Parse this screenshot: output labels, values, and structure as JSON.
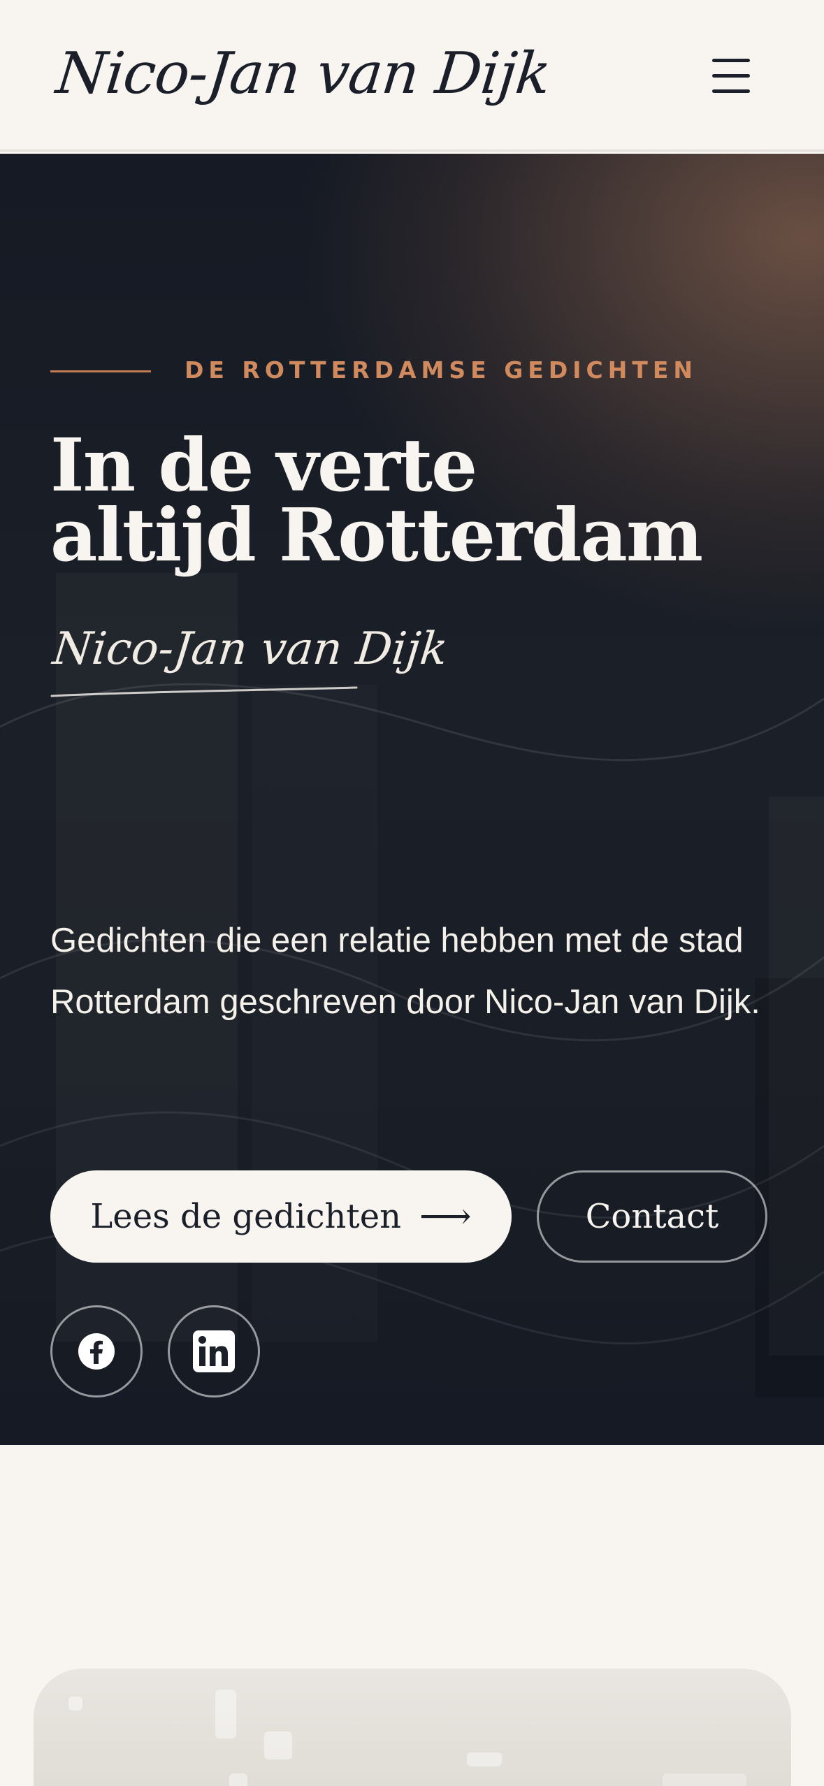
{
  "header": {
    "logo": "Nico-Jan van Dijk",
    "menu_icon": "hamburger-menu-icon"
  },
  "hero": {
    "eyebrow": "DE ROTTERDAMSE GEDICHTEN",
    "title_line1": "In de verte",
    "title_line2": "altijd Rotterdam",
    "signature": "Nico-Jan van Dijk",
    "description": "Gedichten die een relatie hebben met de stad Rotterdam geschreven door Nico-Jan van Dijk.",
    "primary_button": "Lees de gedichten",
    "primary_button_icon": "arrow-right-icon",
    "secondary_button": "Contact",
    "social": [
      {
        "name": "Facebook",
        "icon": "facebook-icon"
      },
      {
        "name": "LinkedIn",
        "icon": "linkedin-icon"
      }
    ]
  },
  "colors": {
    "background": "#f8f5f0",
    "ink": "#1b1f2a",
    "accent": "#d08a5e",
    "hero_dark": "#151a24"
  }
}
